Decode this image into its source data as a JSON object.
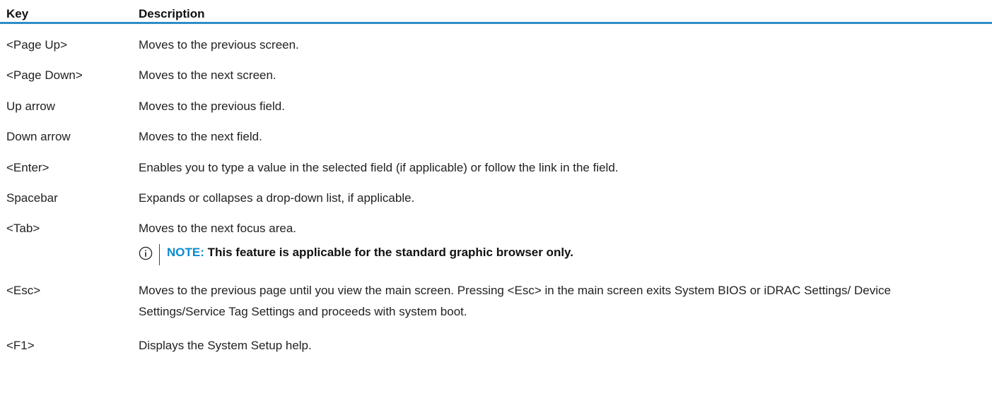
{
  "table": {
    "headers": {
      "key": "Key",
      "description": "Description"
    },
    "rows": [
      {
        "key": "<Page Up>",
        "description": "Moves to the previous screen."
      },
      {
        "key": "<Page Down>",
        "description": "Moves to the next screen."
      },
      {
        "key": "Up arrow",
        "description": "Moves to the previous field."
      },
      {
        "key": "Down arrow",
        "description": "Moves to the next field."
      },
      {
        "key": "<Enter>",
        "description": "Enables you to type a value in the selected field (if applicable) or follow the link in the field."
      },
      {
        "key": "Spacebar",
        "description": "Expands or collapses a drop-down list, if applicable."
      },
      {
        "key": "<Tab>",
        "description": "Moves to the next focus area."
      },
      {
        "key": "<Esc>",
        "description": "Moves to the previous page until you view the main screen. Pressing <Esc> in the main screen exits System BIOS or iDRAC Settings/ Device Settings/Service Tag Settings and proceeds with system boot."
      },
      {
        "key": "<F1>",
        "description": "Displays the System Setup help."
      }
    ],
    "note": {
      "label": "NOTE:",
      "text": " This feature is applicable for the standard graphic browser only.",
      "icon": "info-icon"
    }
  },
  "colors": {
    "accent": "#2e8ec7",
    "note_label": "#0a8ad0",
    "text": "#222222"
  }
}
